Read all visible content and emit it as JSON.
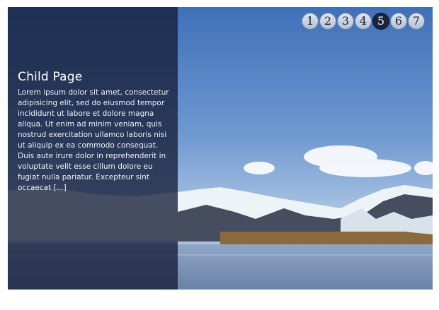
{
  "slide": {
    "title": "Child Page",
    "excerpt": "Lorem ipsum dolor sit amet, consectetur adipisicing elit, sed do eiusmod tempor incididunt ut labore et dolore magna aliqua. Ut enim ad minim veniam, quis nostrud exercitation ullamco laboris nisi ut aliquip ex ea commodo consequat. Duis aute irure dolor in reprehenderit in voluptate velit esse cillum dolore eu fugiat nulla pariatur. Excepteur sint occaecat [...]"
  },
  "pager": {
    "pages": [
      "1",
      "2",
      "3",
      "4",
      "5",
      "6",
      "7"
    ],
    "active": "5"
  },
  "colors": {
    "caption_overlay": "#141e37",
    "pager_active": "#1c2540",
    "pager_inactive": "#c8d2e6"
  }
}
